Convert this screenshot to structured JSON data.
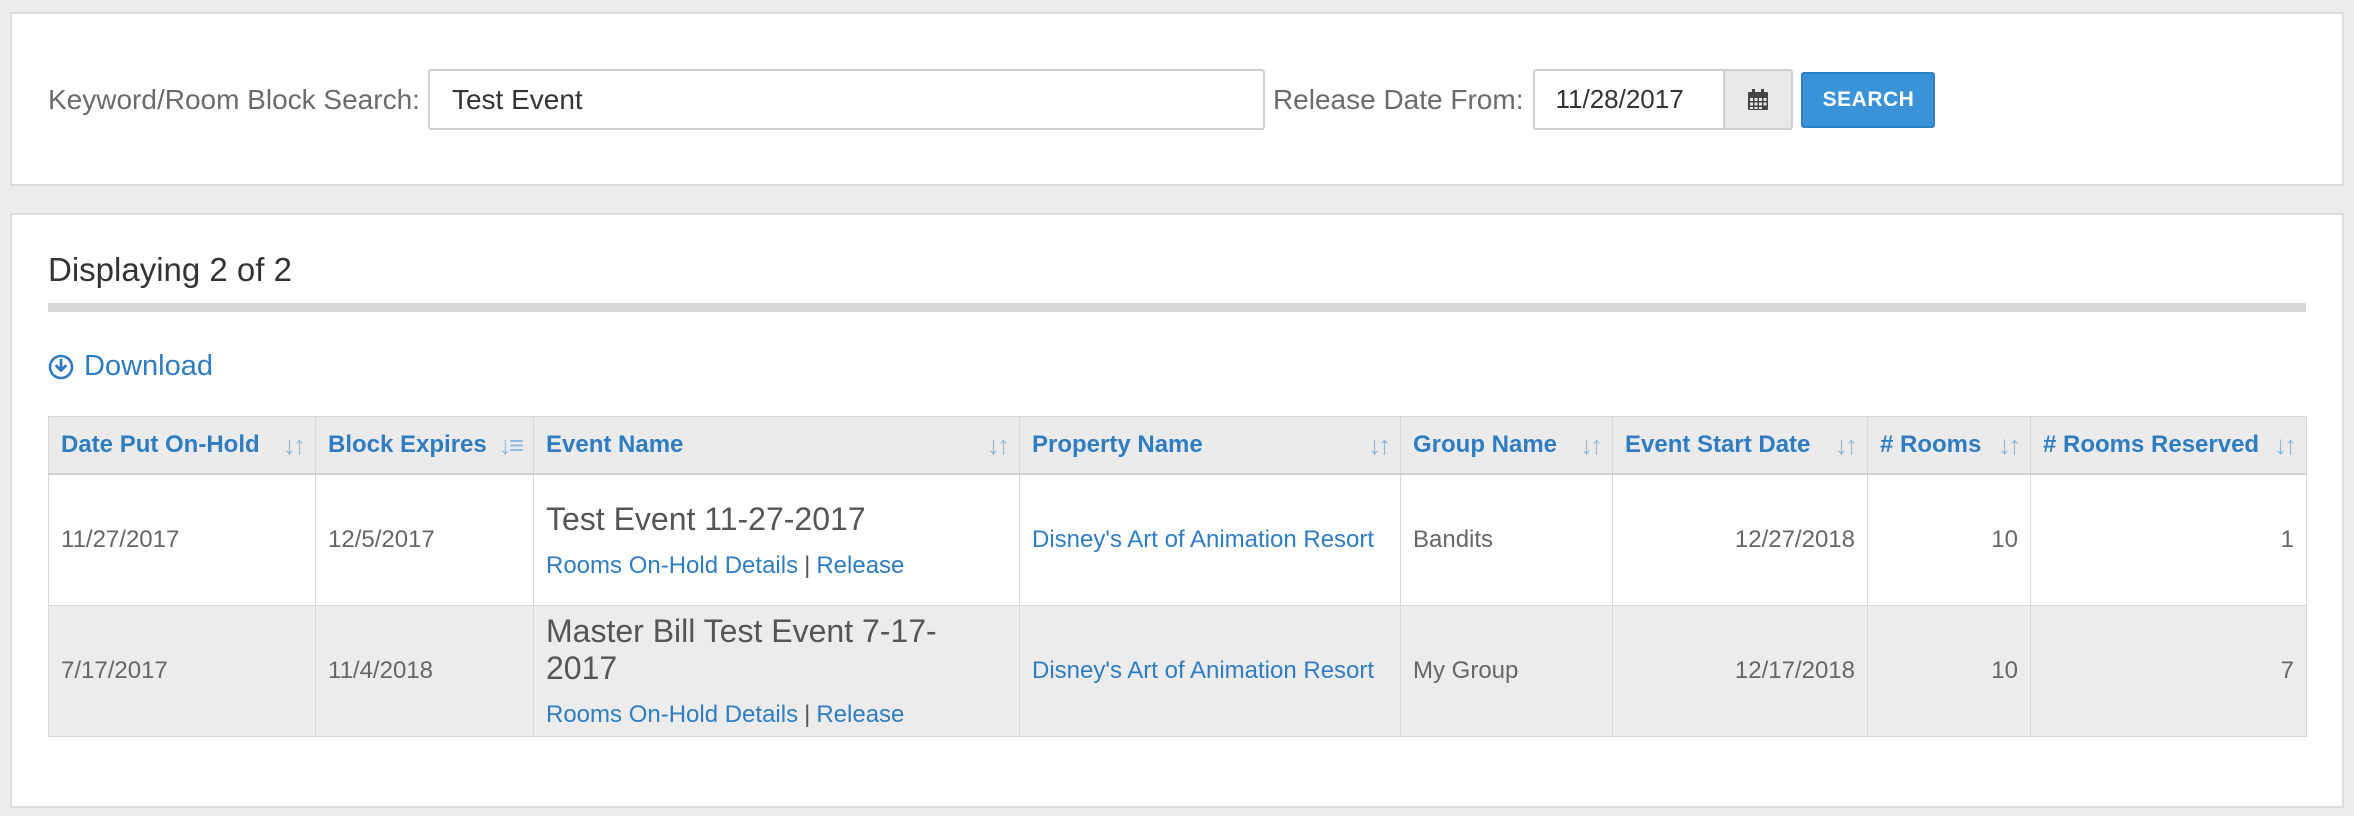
{
  "search": {
    "keyword_label": "Keyword/Room Block Search:",
    "keyword_value": "Test Event",
    "release_label": "Release Date From:",
    "release_value": "11/28/2017",
    "search_button": "SEARCH"
  },
  "results": {
    "displaying": "Displaying 2 of 2",
    "download": "Download",
    "columns": [
      {
        "label": "Date Put On-Hold",
        "sort_icon": "sort-icon"
      },
      {
        "label": "Block Expires",
        "sort_icon": "sort-descending-icon"
      },
      {
        "label": "Event Name",
        "sort_icon": "sort-icon"
      },
      {
        "label": "Property Name",
        "sort_icon": "sort-icon"
      },
      {
        "label": "Group Name",
        "sort_icon": "sort-icon"
      },
      {
        "label": "Event Start Date",
        "sort_icon": "sort-icon"
      },
      {
        "label": "# Rooms",
        "sort_icon": "sort-icon"
      },
      {
        "label": "# Rooms Reserved",
        "sort_icon": "sort-icon"
      }
    ],
    "rows": [
      {
        "date_on_hold": "11/27/2017",
        "block_expires": "12/5/2017",
        "event_name": "Test Event 11-27-2017",
        "details_link": "Rooms On-Hold Details",
        "separator": "|",
        "release_link": "Release",
        "property": "Disney's Art of Animation Resort",
        "group": "Bandits",
        "start_date": "12/27/2018",
        "rooms": "10",
        "rooms_reserved": "1"
      },
      {
        "date_on_hold": "7/17/2017",
        "block_expires": "11/4/2018",
        "event_name": "Master Bill Test Event 7-17-2017",
        "details_link": "Rooms On-Hold Details",
        "separator": "|",
        "release_link": "Release",
        "property": "Disney's Art of Animation Resort",
        "group": "My Group",
        "start_date": "12/17/2018",
        "rooms": "10",
        "rooms_reserved": "7"
      }
    ]
  },
  "colors": {
    "link": "#2f7dc0",
    "button": "#3a93d8",
    "header_bg": "#ebebeb"
  },
  "icons": {
    "calendar": "calendar-icon",
    "download": "download-circle-icon"
  }
}
